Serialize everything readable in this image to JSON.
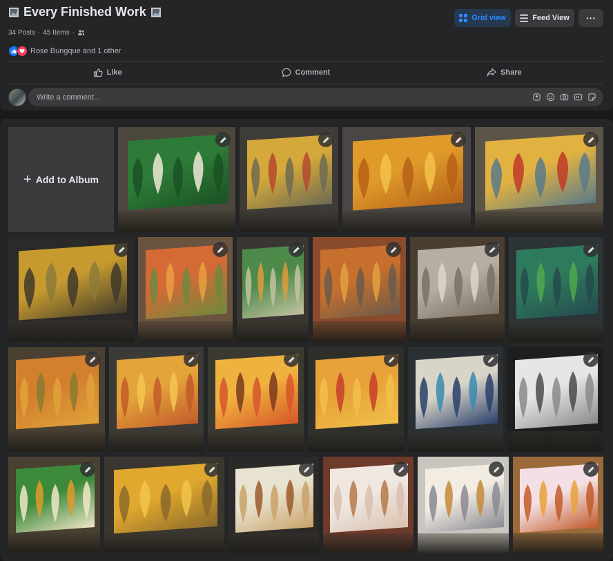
{
  "album": {
    "title": "Every Finished Work",
    "posts": "34 Posts",
    "items": "45 Items",
    "separator": "·"
  },
  "reactions": {
    "text": "Rose Bungque and 1 other"
  },
  "view_buttons": {
    "grid": "Grid view",
    "feed": "Feed View",
    "more": "···"
  },
  "actions": {
    "like": "Like",
    "comment": "Comment",
    "share": "Share"
  },
  "comment": {
    "placeholder": "Write a comment..."
  },
  "grid": {
    "add_label": "Add to Album"
  },
  "colors": {
    "accent": "#2d88ff",
    "background": "#18191a",
    "card": "#242526",
    "tile": "#3a3b3c"
  },
  "photos": [
    {
      "name": "green-white-leaves",
      "bg": "#4c473c",
      "canvas": "#2e7a38",
      "accent": "#efe9d4",
      "accent2": "#1a5224"
    },
    {
      "name": "yellow-red-tulips",
      "bg": "#3e3c39",
      "canvas": "#d4a83a",
      "accent": "#b44a2e",
      "accent2": "#6d6b52"
    },
    {
      "name": "orange-leaves",
      "bg": "#4a4644",
      "canvas": "#e09a2a",
      "accent": "#f2c24a",
      "accent2": "#b56218"
    },
    {
      "name": "yellow-red-buds",
      "bg": "#5c5446",
      "canvas": "#e2b240",
      "accent": "#c03a28",
      "accent2": "#5a7a8a"
    },
    {
      "name": "dark-yellow-leaves",
      "bg": "#2c2a28",
      "canvas": "#c79a30",
      "accent": "#8d7a3a",
      "accent2": "#3f3a2a"
    },
    {
      "name": "orange-red-green",
      "bg": "#6a5440",
      "canvas": "#d46a36",
      "accent": "#e8a040",
      "accent2": "#6c8a3c"
    },
    {
      "name": "green-orange-small",
      "bg": "#3a3632",
      "canvas": "#4e8a4a",
      "accent": "#e09a3a",
      "accent2": "#c2c2a0"
    },
    {
      "name": "orange-wall-piece",
      "bg": "#8a4a2c",
      "canvas": "#c7702e",
      "accent": "#e3a040",
      "accent2": "#6a5a4a"
    },
    {
      "name": "grey-line-art",
      "bg": "#4a3e30",
      "canvas": "#b6aea2",
      "accent": "#dcd6cc",
      "accent2": "#7a7064"
    },
    {
      "name": "green-teal",
      "bg": "#2c3436",
      "canvas": "#2e7a5c",
      "accent": "#4fa84c",
      "accent2": "#244a4e"
    },
    {
      "name": "orange-olive",
      "bg": "#4a4032",
      "canvas": "#d2802e",
      "accent": "#8a7a30",
      "accent2": "#e0a23a"
    },
    {
      "name": "yellow-orange",
      "bg": "#3c3a36",
      "canvas": "#e3a43a",
      "accent": "#f4c650",
      "accent2": "#c25a2a"
    },
    {
      "name": "yellow-brown-tulips",
      "bg": "#3a3a30",
      "canvas": "#f0b23e",
      "accent": "#7a3a1e",
      "accent2": "#d6562a"
    },
    {
      "name": "orange-red-large",
      "bg": "#2e2e2a",
      "canvas": "#e6a238",
      "accent": "#c6402a",
      "accent2": "#f2c04a"
    },
    {
      "name": "portrait-drawing",
      "bg": "#2a3034",
      "canvas": "#d8d4c8",
      "accent": "#3a8ab0",
      "accent2": "#2a3f6a"
    },
    {
      "name": "pencil-portrait",
      "bg": "#1e1e1e",
      "canvas": "#e6e6e6",
      "accent": "#4a4a4a",
      "accent2": "#8a8a8a"
    },
    {
      "name": "green-orange-leaves",
      "bg": "#4a4032",
      "canvas": "#3c8a3a",
      "accent": "#e09a2a",
      "accent2": "#f0e6c8"
    },
    {
      "name": "yellow-mustard",
      "bg": "#3a3630",
      "canvas": "#e0a82e",
      "accent": "#f2c44a",
      "accent2": "#8a6a2a"
    },
    {
      "name": "white-brown-petals",
      "bg": "#2c2a28",
      "canvas": "#e8e2d0",
      "accent": "#9a5a2a",
      "accent2": "#c9a268"
    },
    {
      "name": "white-rose-petals",
      "bg": "#6e3a2a",
      "canvas": "#f0e8e0",
      "accent": "#b47a4a",
      "accent2": "#d8c0b0"
    },
    {
      "name": "white-brown-wall",
      "bg": "#c9c6c0",
      "canvas": "#f2ece2",
      "accent": "#c48a3a",
      "accent2": "#8a8a92"
    },
    {
      "name": "pink-yellow-tulips",
      "bg": "#9a6a3a",
      "canvas": "#f4e0e4",
      "accent": "#e8a23a",
      "accent2": "#c25a2a"
    }
  ]
}
